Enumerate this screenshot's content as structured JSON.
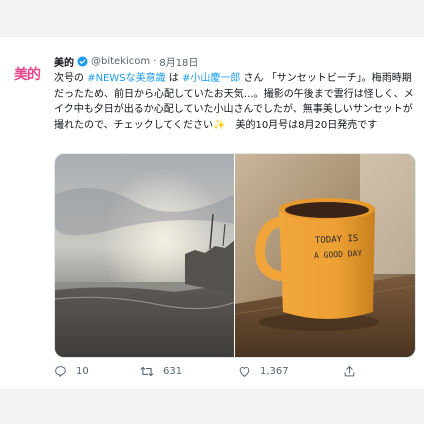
{
  "tweet": {
    "avatar_text": "美的",
    "author_name": "美的",
    "handle": "@bitekicom",
    "separator": "·",
    "date": "8月18日",
    "text_parts": [
      {
        "text": "次号の "
      },
      {
        "text": "#NEWSな美意識",
        "link": true
      },
      {
        "text": " は "
      },
      {
        "text": "#小山慶一郎",
        "link": true
      },
      {
        "text": " さん 「サンセットビーチ」。梅雨時期だったため、前日から心配していたお天気…。撮影の午後まで雲行は怪しく、メイク中も夕日が出るか心配していた小山さんでしたが、無事美しいサンセットが撮れたので、チェックしてください✨　美的10月号は8月20日発売です"
      }
    ],
    "mug_text_1": "TODAY IS",
    "mug_text_2": "A GOOD DAY"
  },
  "actions": {
    "reply_count": "10",
    "retweet_count": "631",
    "like_count": "1,367"
  },
  "colors": {
    "link": "#1d9bf0",
    "brand_pink": "#e8478e",
    "mug_yellow": "#f2a73a"
  }
}
